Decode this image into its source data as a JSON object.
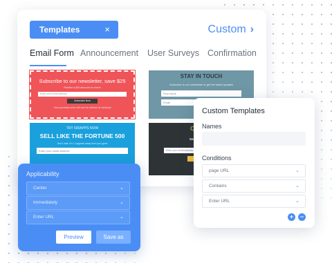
{
  "header": {
    "templates_pill_label": "Templates",
    "templates_pill_close": "×",
    "custom_link_label": "Custom",
    "custom_link_chevron": "›"
  },
  "tabs": [
    {
      "label": "Email Form",
      "active": true
    },
    {
      "label": "Announcement",
      "active": false
    },
    {
      "label": "User Surveys",
      "active": false
    },
    {
      "label": "Confirmation",
      "active": false
    }
  ],
  "templates": {
    "newsletter": {
      "heading": "Subscribe to our newsletter, save $25",
      "subtext": "Receive a $25 discount on orders",
      "input_placeholder": "Enter your email address",
      "button_label": "Subscribe Now",
      "footer": "Your purchase price will now be allowed at checkout"
    },
    "stay_in_touch": {
      "heading": "STAY IN TOUCH",
      "subtext": "Subscribe to our newsletter to get the latest updates",
      "first_name_placeholder": "First name",
      "email_placeholder": "Email"
    },
    "fortune": {
      "pretitle": "TRY 500APPS NOW",
      "heading": "SELL LIKE THE FORTUNE 500",
      "subtext": "Don't wait. It's 1 upgrade away from you grow",
      "input_placeholder": "Enter your email address"
    },
    "dark": {
      "heading": "Can you",
      "subtext": "Secret sales are",
      "input_placeholder": "Enter your email address"
    }
  },
  "custom_templates": {
    "title": "Custom Templates",
    "names_label": "Names",
    "names_value": "",
    "conditions_label": "Conditions",
    "conditions": [
      {
        "value": "page URL"
      },
      {
        "value": "Contains"
      },
      {
        "value": "Enter URL"
      }
    ],
    "add_symbol": "+",
    "remove_symbol": "−",
    "chevron": "⌄"
  },
  "applicability": {
    "title": "Applicability",
    "selects": [
      {
        "value": "Center"
      },
      {
        "value": "Immediately"
      },
      {
        "value": "Enter URL"
      }
    ],
    "preview_label": "Preview",
    "save_label": "Save as",
    "chevron": "⌄"
  },
  "colors": {
    "accent": "#4a8ef5",
    "newsletter_bg": "#ef5458",
    "stay_in_touch_bg": "#6f97a6",
    "fortune_bg": "#1aa0dc",
    "dark_bg": "#2e3336"
  }
}
